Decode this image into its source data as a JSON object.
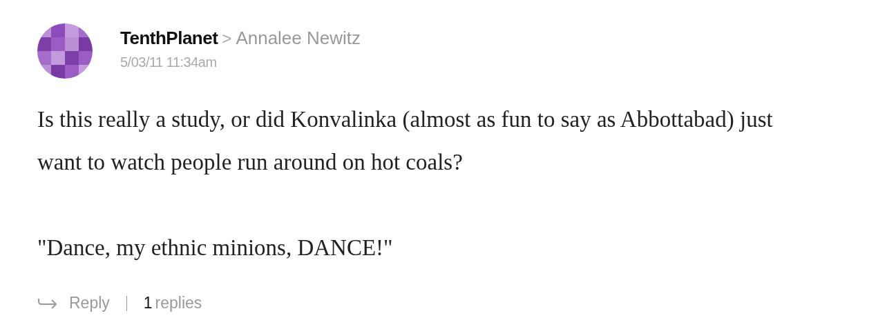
{
  "comment": {
    "author": "TenthPlanet",
    "separator": ">",
    "recipient": "Annalee Newitz",
    "timestamp": "5/03/11 11:34am",
    "paragraphs": [
      "Is this really a study, or did Konvalinka (almost as fun to say as Abbottabad) just want to watch people run around on hot coals?",
      "\"Dance, my ethnic minions, DANCE!\""
    ],
    "actions": {
      "reply": "Reply",
      "reply_count": "1",
      "replies_label": "replies"
    }
  }
}
